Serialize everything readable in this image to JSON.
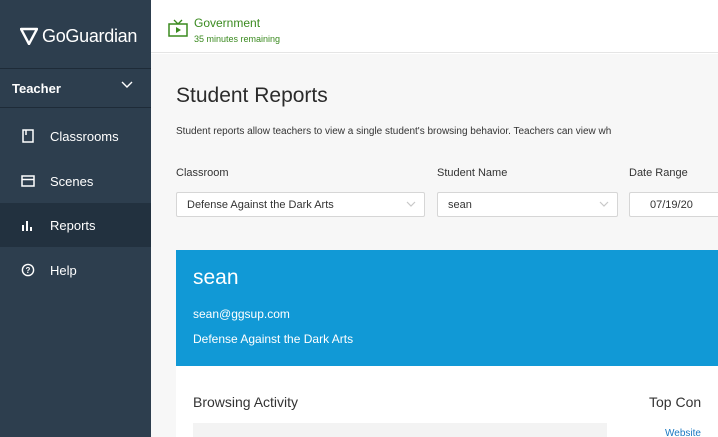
{
  "sidebar": {
    "logo_text": "GoGuardian",
    "role": "Teacher",
    "items": [
      {
        "label": "Classrooms",
        "icon": "classroom-icon"
      },
      {
        "label": "Scenes",
        "icon": "scenes-icon"
      },
      {
        "label": "Reports",
        "icon": "reports-icon",
        "active": true
      },
      {
        "label": "Help",
        "icon": "help-icon"
      }
    ]
  },
  "session": {
    "title": "Government",
    "subtitle": "35 minutes remaining",
    "color": "#3a8a1f"
  },
  "main": {
    "title": "Student Reports",
    "description": "Student reports allow teachers to view a single student's browsing behavior. Teachers can view wh",
    "filters": {
      "classroom_label": "Classroom",
      "classroom_value": "Defense Against the Dark Arts",
      "student_label": "Student Name",
      "student_value": "sean",
      "date_label": "Date Range",
      "date_value": "07/19/20"
    },
    "student": {
      "name": "sean",
      "email": "sean@ggsup.com",
      "classroom": "Defense Against the Dark Arts",
      "card_color": "#1199d6"
    },
    "browsing_title": "Browsing Activity",
    "top_title": "Top Con",
    "top_link": "Website"
  }
}
